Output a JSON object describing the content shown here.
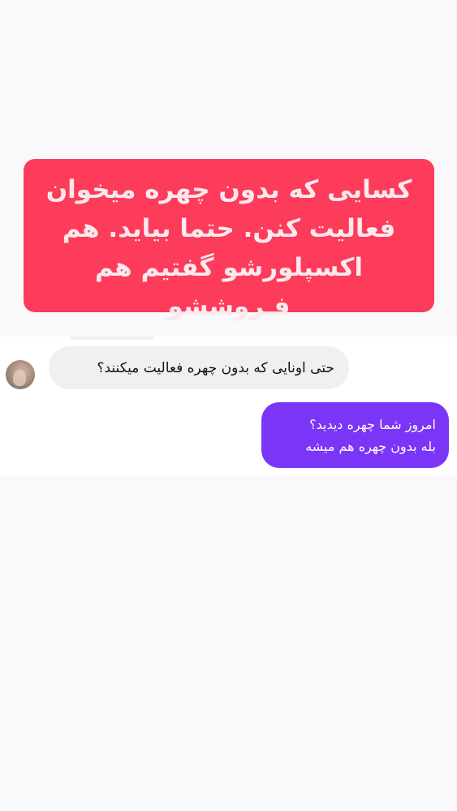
{
  "banner": {
    "line1": "کسایی که بدون چهره میخوان",
    "line2": "فعالیت کنن. حتما بیاید. هم",
    "line3": "اکسپلورشو گفتیم هم فـروششو",
    "background_color": "#fd3b5a"
  },
  "conversation": {
    "incoming_message": "حتی اونایی که بدون چهره فعالیت میکنند؟",
    "outgoing_message": {
      "line1": "امروز شما چهره دیدید؟",
      "line2": "بله بدون چهره هم میشه"
    },
    "incoming_bubble_color": "#f0f0f2",
    "outgoing_bubble_color": "#7a35f7"
  }
}
